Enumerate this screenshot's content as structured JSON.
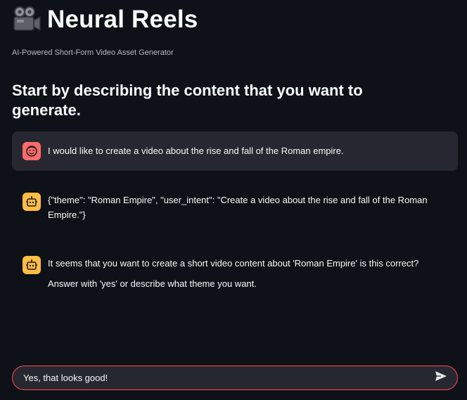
{
  "app": {
    "title": "Neural Reels",
    "title_icon": "movie-camera-icon",
    "subtitle": "AI-Powered Short-Form Video Asset Generator"
  },
  "main": {
    "heading": "Start by describing the content that you want to generate."
  },
  "messages": [
    {
      "role": "user",
      "avatar_icon": "user-face-icon",
      "avatar_color": "#ff6b6b",
      "lines": [
        "I would like to create a video about the rise and fall of the Roman empire."
      ]
    },
    {
      "role": "assistant",
      "avatar_icon": "robot-icon",
      "avatar_color": "#ffbd45",
      "lines": [
        "{\"theme\": \"Roman Empire\", \"user_intent\": \"Create a video about the rise and fall of the Roman Empire.\"}"
      ]
    },
    {
      "role": "assistant",
      "avatar_icon": "robot-icon",
      "avatar_color": "#ffbd45",
      "lines": [
        "It seems that you want to create a short video content about 'Roman Empire' is this correct?",
        "Answer with 'yes' or describe what theme you want."
      ]
    }
  ],
  "chat_input": {
    "value": "Yes, that looks good!",
    "send_icon": "send-icon",
    "border_color": "#ff4b4b"
  }
}
